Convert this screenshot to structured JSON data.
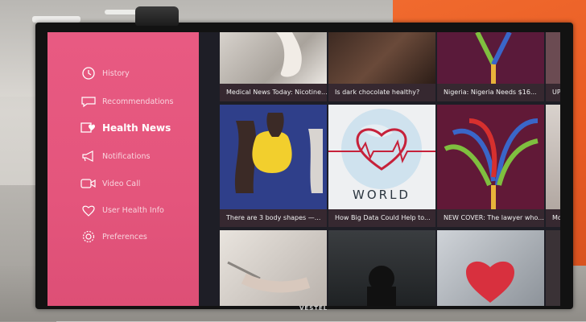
{
  "tv": {
    "brand": "VESTEL"
  },
  "sidebar": {
    "items": [
      {
        "label": "History",
        "icon": "clock-icon"
      },
      {
        "label": "Recommendations",
        "icon": "chat-bubble-icon"
      },
      {
        "label": "Health News",
        "icon": "heart-news-icon"
      },
      {
        "label": "Notifications",
        "icon": "megaphone-icon"
      },
      {
        "label": "Video Call",
        "icon": "video-call-icon"
      },
      {
        "label": "User Health Info",
        "icon": "heart-pin-icon"
      },
      {
        "label": "Preferences",
        "icon": "settings-icon"
      }
    ],
    "active": "Health News"
  },
  "news": {
    "row1": [
      {
        "caption": "Medical News Today: Nicotine..."
      },
      {
        "caption": "Is dark chocolate healthy?"
      },
      {
        "caption": "Nigeria: Nigeria Needs $16..."
      },
      {
        "caption": "UP"
      }
    ],
    "row2": [
      {
        "caption": "There are 3 body shapes —..."
      },
      {
        "caption": "How Big Data Could Help to..."
      },
      {
        "caption": "NEW COVER: The lawyer who..."
      },
      {
        "caption": "Mo"
      }
    ],
    "world_graphic_text": "WORLD"
  },
  "colors": {
    "sidebar": "#e4557c",
    "accent_red": "#c6213a",
    "caption_bg": "#372830"
  }
}
